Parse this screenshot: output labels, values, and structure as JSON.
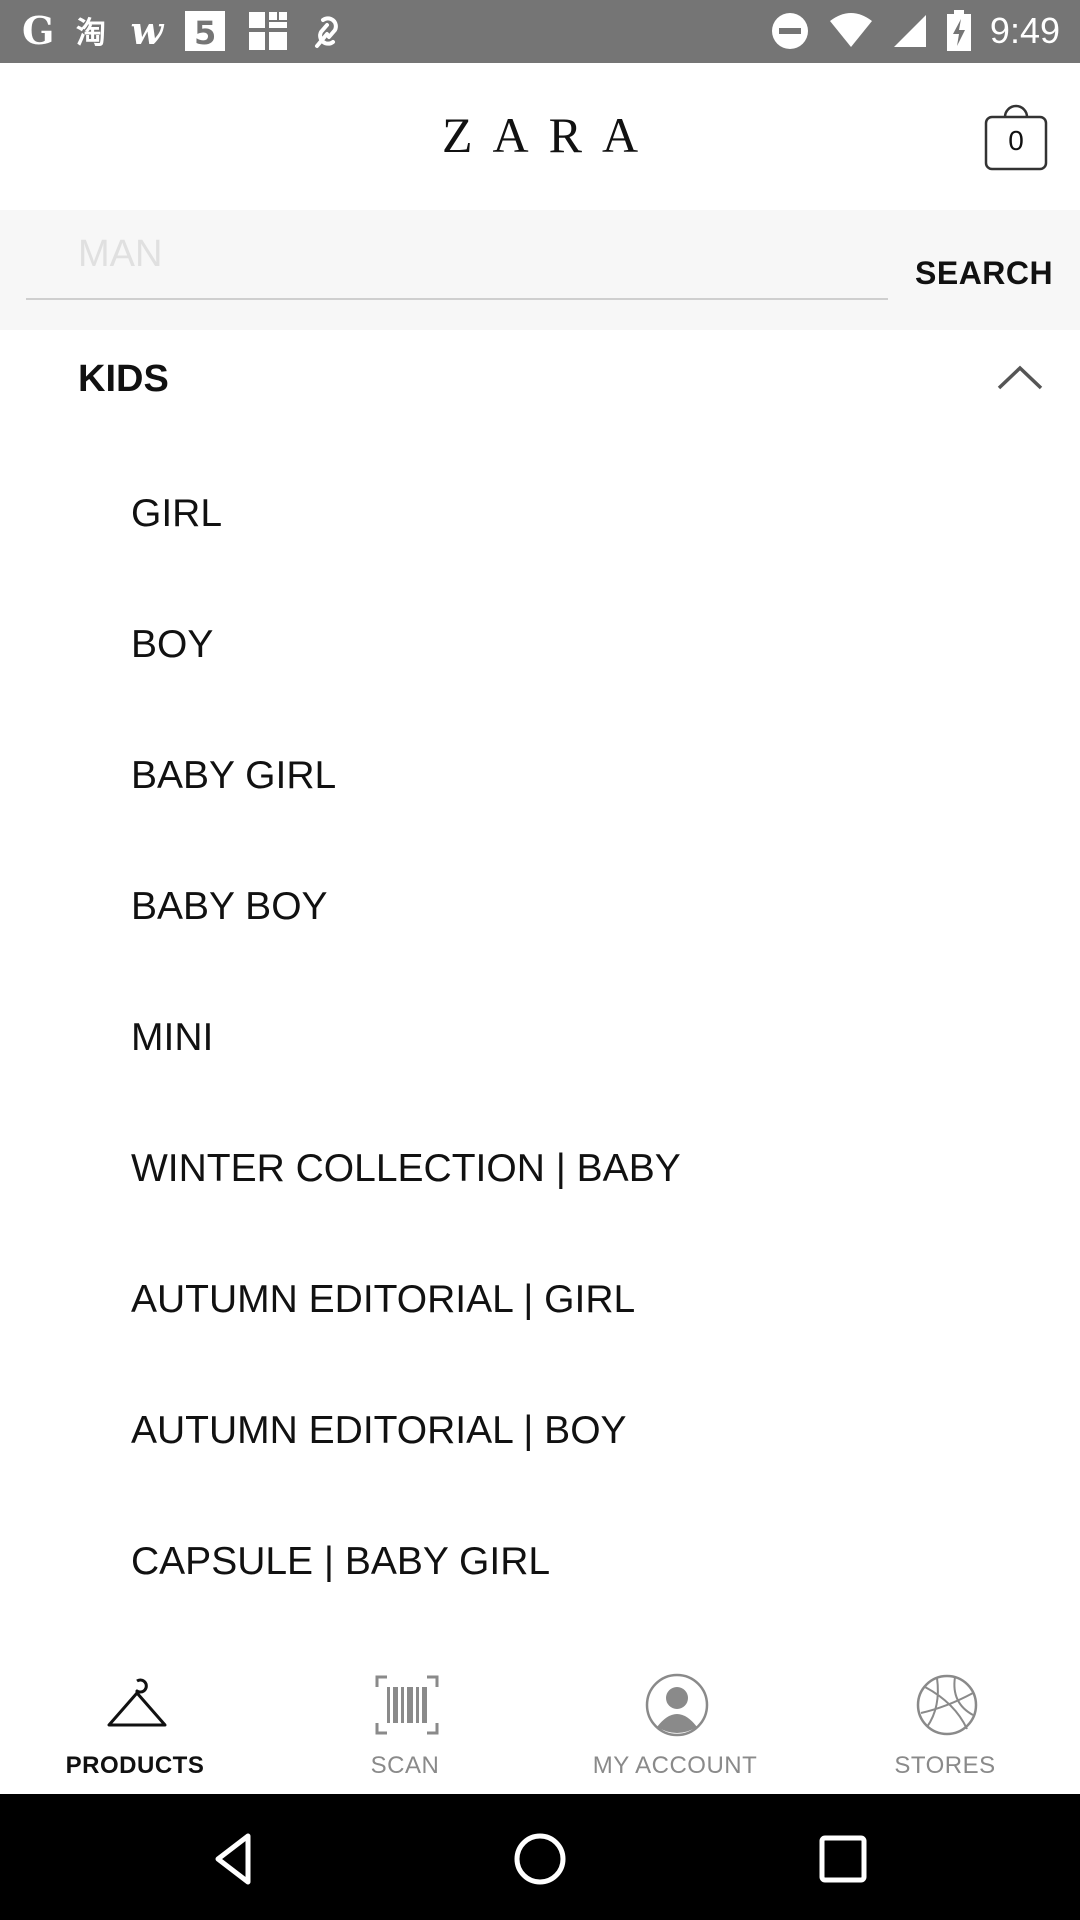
{
  "status_bar": {
    "time": "9:49",
    "icons": [
      "google-icon",
      "taobao-icon",
      "w-icon",
      "html5-icon",
      "grid-app-icon",
      "link-icon",
      "do-not-disturb-icon",
      "wifi-icon",
      "signal-icon",
      "battery-charging-icon"
    ]
  },
  "header": {
    "logo": "ZARA",
    "cart_count": "0"
  },
  "search": {
    "placeholder": "MAN",
    "button_label": "SEARCH"
  },
  "section": {
    "title": "KIDS",
    "expanded": true
  },
  "menu_items": [
    "GIRL",
    "BOY",
    "BABY GIRL",
    "BABY BOY",
    "MINI",
    "WINTER COLLECTION | BABY",
    "AUTUMN EDITORIAL | GIRL",
    "AUTUMN EDITORIAL | BOY",
    "CAPSULE | BABY GIRL"
  ],
  "bottom_nav": [
    {
      "label": "PRODUCTS",
      "icon": "hanger-icon",
      "active": true
    },
    {
      "label": "SCAN",
      "icon": "barcode-icon",
      "active": false
    },
    {
      "label": "MY ACCOUNT",
      "icon": "account-icon",
      "active": false
    },
    {
      "label": "STORES",
      "icon": "globe-icon",
      "active": false
    }
  ],
  "colors": {
    "status_bar": "#757575",
    "text": "#111111",
    "inactive": "#8a8a8a",
    "system_nav": "#000000"
  }
}
